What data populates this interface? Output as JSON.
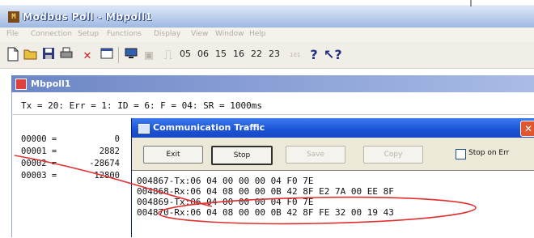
{
  "app": {
    "title": "Modbus Poll - Mbpoll1"
  },
  "menu": [
    "File",
    "Connection",
    "Setup",
    "Functions",
    "Display",
    "View",
    "Window",
    "Help"
  ],
  "toolbar": {
    "function_codes": [
      "05",
      "06",
      "15",
      "16",
      "22",
      "23"
    ],
    "extra": "101"
  },
  "doc": {
    "title": "Mbpoll1",
    "status": "Tx = 20: Err = 1: ID = 6: F = 04: SR = 1000ms",
    "registers": [
      {
        "addr": "00000 =",
        "value": "0"
      },
      {
        "addr": "00001 =",
        "value": "2882"
      },
      {
        "addr": "00002 =",
        "value": "-28674"
      },
      {
        "addr": "00003 =",
        "value": "12800"
      }
    ]
  },
  "traffic": {
    "title": "Communication Traffic",
    "buttons": {
      "exit": "Exit",
      "stop": "Stop",
      "save": "Save",
      "copy": "Copy"
    },
    "stop_on_error_label": "Stop on Err",
    "stop_on_error_checked": false,
    "log": [
      "004867-Tx:06 04 00 00 00 04 F0 7E",
      "004868-Rx:06 04 08 00 00 0B 42 8F E2 7A 00 EE 8F",
      "004869-Tx:06 04 00 00 00 04 F0 7E",
      "004870-Rx:06 04 08 00 00 0B 42 8F FE 32 00 19 43"
    ]
  },
  "colors": {
    "annotation": "#e03030",
    "dialog_title": "#1a52d6",
    "close_button": "#e0562f"
  }
}
